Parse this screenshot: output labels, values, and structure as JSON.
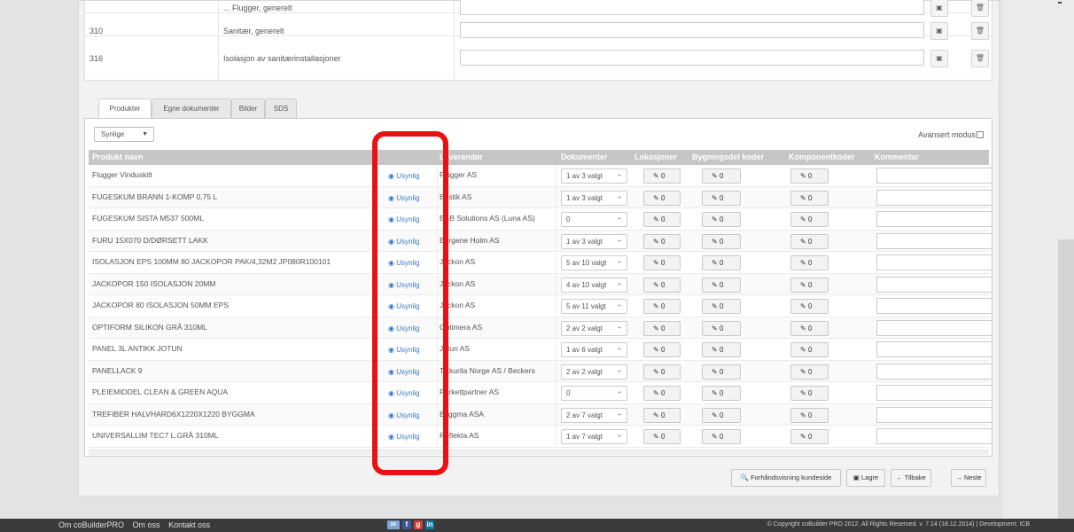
{
  "top_table": {
    "rows": [
      {
        "code": "310",
        "description": "Sanitær, generelt"
      },
      {
        "code": "316",
        "description": "Isolasjon av sanitærinstallasjoner"
      }
    ],
    "cut_row_description": "... Flugger, generelt"
  },
  "tabs": [
    "Produkter",
    "Egne dokumenter",
    "Bilder",
    "SDS"
  ],
  "filter_select": {
    "value": "Synlige"
  },
  "advanced_mode_label": "Avansert modus",
  "grid": {
    "headers": {
      "name": "Produkt navn",
      "supplier": "Leverandør",
      "documents": "Dokumenter",
      "locations": "Lokasjoner",
      "building_codes": "Bygningsdel koder",
      "component_codes": "Komponentkoder",
      "comment": "Kommentar"
    },
    "visibility_label": "Usynlig",
    "rows": [
      {
        "name": "Flugger Vinduskitt",
        "supplier": "Flügger AS",
        "documents": "1 av 3 valgt",
        "locations": "0",
        "building_codes": "0",
        "component_codes": "0"
      },
      {
        "name": "FUGESKUM BRANN 1-KOMP 0,75 L",
        "supplier": "Bostik AS",
        "documents": "1 av 3 valgt",
        "locations": "0",
        "building_codes": "0",
        "component_codes": "0"
      },
      {
        "name": "FUGESKUM SISTA M537 500ML",
        "supplier": "B&B Solutions AS (Luna AS)",
        "documents": "0",
        "locations": "0",
        "building_codes": "0",
        "component_codes": "0"
      },
      {
        "name": "FURU 15X070 D/DØRSETT LAKK",
        "supplier": "Bergene Holm AS",
        "documents": "1 av 3 valgt",
        "locations": "0",
        "building_codes": "0",
        "component_codes": "0"
      },
      {
        "name": "ISOLASJON EPS 100MM 80 JACKOPOR PAK/4,32M2 JP080R100101",
        "supplier": "Jackon AS",
        "documents": "5 av 10 valgt",
        "locations": "0",
        "building_codes": "0",
        "component_codes": "0"
      },
      {
        "name": "JACKOPOR 150 ISOLASJON 20MM",
        "supplier": "Jackon AS",
        "documents": "4 av 10 valgt",
        "locations": "0",
        "building_codes": "0",
        "component_codes": "0"
      },
      {
        "name": "JACKOPOR 80 ISOLASJON 50MM EPS",
        "supplier": "Jackon AS",
        "documents": "5 av 11 valgt",
        "locations": "0",
        "building_codes": "0",
        "component_codes": "0"
      },
      {
        "name": "OPTIFORM SILIKON GRÅ 310ML",
        "supplier": "Optimera AS",
        "documents": "2 av 2 valgt",
        "locations": "0",
        "building_codes": "0",
        "component_codes": "0"
      },
      {
        "name": "PANEL 3L ANTIKK JOTUN",
        "supplier": "Jotun AS",
        "documents": "1 av 6 valgt",
        "locations": "0",
        "building_codes": "0",
        "component_codes": "0"
      },
      {
        "name": "PANELLACK 9",
        "supplier": "Tikkurila Norge AS / Beckers",
        "documents": "2 av 2 valgt",
        "locations": "0",
        "building_codes": "0",
        "component_codes": "0"
      },
      {
        "name": "PLEIEMIDDEL CLEAN & GREEN AQUA",
        "supplier": "Parkettpartner AS",
        "documents": "0",
        "locations": "0",
        "building_codes": "0",
        "component_codes": "0"
      },
      {
        "name": "TREFIBER HALVHARD6X1220X1220 BYGGMA",
        "supplier": "Byggma ASA",
        "documents": "2 av 7 valgt",
        "locations": "0",
        "building_codes": "0",
        "component_codes": "0"
      },
      {
        "name": "UNIVERSALLIM TEC7 L.GRÅ 310ML",
        "supplier": "Reflekta AS",
        "documents": "1 av 7 valgt",
        "locations": "0",
        "building_codes": "0",
        "component_codes": "0"
      }
    ]
  },
  "actions": {
    "preview": "Forhåndsvisning kundeside",
    "save": "Lagre",
    "back": "Tilbake",
    "next": "Neste"
  },
  "footer": {
    "links": [
      "Om coBuilderPRO",
      "Om oss",
      "Kontakt oss"
    ],
    "copyright": "© Copyright coBuilder PRO 2012. All Rights Reserved. v. 7.14 (18.12.2014) | Development: ICB"
  },
  "colors": {
    "highlight": "#e81212",
    "header_bg": "#c6c6c6",
    "link_blue": "#3a79c9",
    "footer_bg": "#3a3a3a"
  }
}
